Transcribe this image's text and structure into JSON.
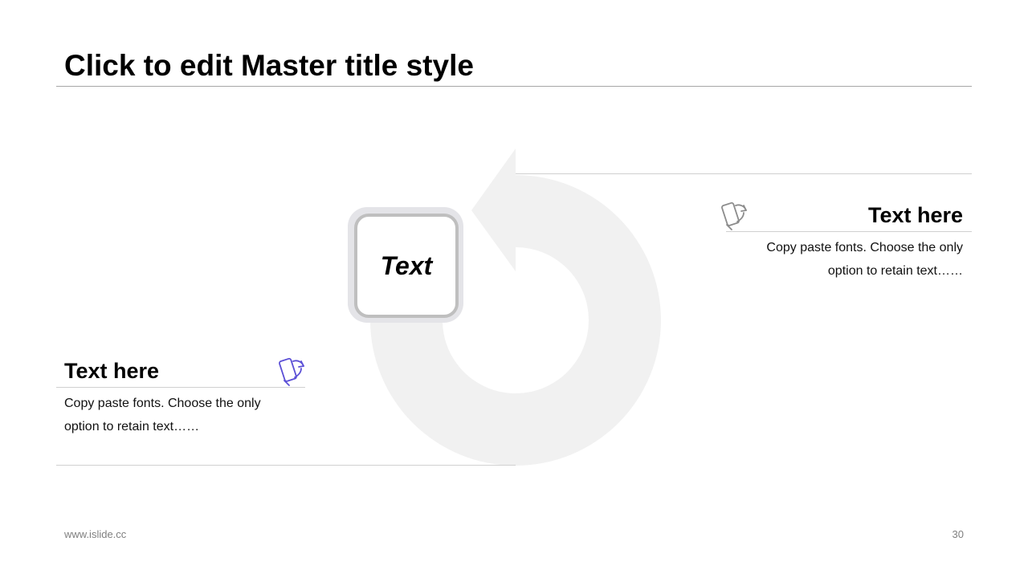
{
  "slide": {
    "title": "Click to edit Master title style",
    "center_label": "Text"
  },
  "right_block": {
    "heading": "Text here",
    "body": "Copy paste fonts. Choose the only option to retain text……",
    "icon": "phone-rotate-icon",
    "icon_color": "#8c8c8c"
  },
  "left_block": {
    "heading": "Text here",
    "body": "Copy paste fonts. Choose the only option to retain text……",
    "icon": "phone-rotate-icon",
    "icon_color": "#5b4fd6"
  },
  "footer": {
    "website": "www.islide.cc",
    "page_number": "30"
  },
  "colors": {
    "arrow": "#f1f1f1",
    "rule": "#a6a6a6"
  }
}
